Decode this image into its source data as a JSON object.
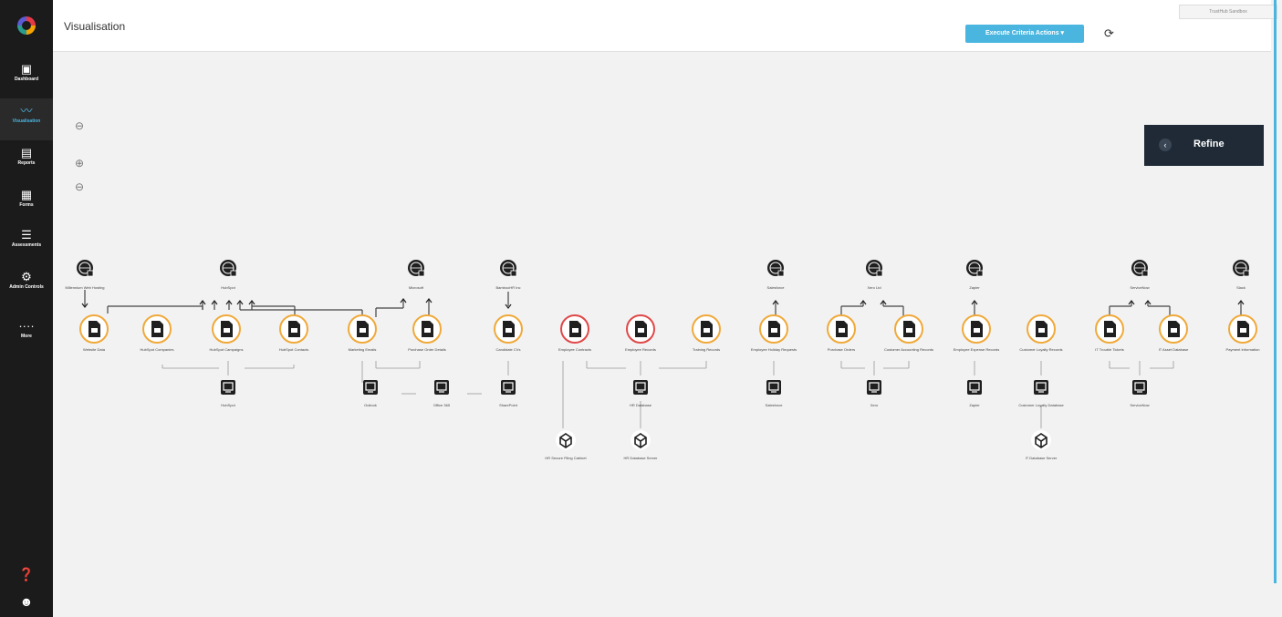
{
  "app": {
    "tenant_label": "TrustHub Sandbox"
  },
  "sidebar": {
    "items": [
      {
        "label": "Dashboard",
        "icon": "dashboard-icon"
      },
      {
        "label": "Visualisation",
        "icon": "chart-line-icon",
        "active": true
      },
      {
        "label": "Reports",
        "icon": "report-icon"
      },
      {
        "label": "Forms",
        "icon": "forms-icon"
      },
      {
        "label": "Assessments",
        "icon": "assessments-icon"
      },
      {
        "label": "Admin Controls",
        "icon": "gear-icon"
      },
      {
        "label": "More",
        "icon": "more-icon"
      }
    ],
    "help_icon": "help-icon",
    "user_icon": "user-icon"
  },
  "header": {
    "title": "Visualisation",
    "execute_button": "Execute Criteria Actions ▾",
    "refresh_icon": "refresh-icon"
  },
  "toolbar": {
    "fit_icon": "fit-view-icon",
    "zoom_in_icon": "zoom-in-icon",
    "zoom_out_icon": "zoom-out-icon"
  },
  "refine": {
    "label": "Refine"
  },
  "colors": {
    "accent": "#4ab6e0",
    "orange_ring": "#f0a93a",
    "red_ring": "#e04848",
    "sidebar": "#1b1b1b",
    "refine_bg": "#1f2a36"
  },
  "graph": {
    "vendors": [
      {
        "id": "v1",
        "label": "Millennium Web Hosting"
      },
      {
        "id": "v2",
        "label": "HubSpot"
      },
      {
        "id": "v3",
        "label": "Microsoft"
      },
      {
        "id": "v4",
        "label": "BambooHR Inc"
      },
      {
        "id": "v5",
        "label": "Salesforce"
      },
      {
        "id": "v6",
        "label": "Xero Ltd"
      },
      {
        "id": "v7",
        "label": "Zapier"
      },
      {
        "id": "v8",
        "label": "ServiceNow"
      },
      {
        "id": "v9",
        "label": "Slack"
      }
    ],
    "records": [
      {
        "label": "Website Data",
        "ring": "orange"
      },
      {
        "label": "HubSpot Companies",
        "ring": "orange"
      },
      {
        "label": "HubSpot Campaigns",
        "ring": "orange"
      },
      {
        "label": "HubSpot Contacts",
        "ring": "orange"
      },
      {
        "label": "Marketing Emails",
        "ring": "orange"
      },
      {
        "label": "Purchase Order Details",
        "ring": "orange"
      },
      {
        "label": "Candidate CVs",
        "ring": "orange"
      },
      {
        "label": "Employee Contracts",
        "ring": "red"
      },
      {
        "label": "Employee Records",
        "ring": "red"
      },
      {
        "label": "Training Records",
        "ring": "orange"
      },
      {
        "label": "Employee Holiday Requests",
        "ring": "orange"
      },
      {
        "label": "Purchase Orders",
        "ring": "orange"
      },
      {
        "label": "Customer Accounting Records",
        "ring": "orange"
      },
      {
        "label": "Employee Expense Records",
        "ring": "orange"
      },
      {
        "label": "Customer Loyalty Records",
        "ring": "orange"
      },
      {
        "label": "IT Trouble Tickets",
        "ring": "orange"
      },
      {
        "label": "IT Asset Database",
        "ring": "orange"
      },
      {
        "label": "Payment Information",
        "ring": "orange"
      }
    ],
    "systems": [
      {
        "label": "HubSpot"
      },
      {
        "label": "Outlook"
      },
      {
        "label": "Office 365"
      },
      {
        "label": "SharePoint"
      },
      {
        "label": "HR Database"
      },
      {
        "label": "Salesforce"
      },
      {
        "label": "Xero"
      },
      {
        "label": "Zapier"
      },
      {
        "label": "Customer Loyalty Database"
      },
      {
        "label": "ServiceNow"
      }
    ],
    "datastores": [
      {
        "label": "HR Secure Filing Cabinet"
      },
      {
        "label": "HR Database Server"
      },
      {
        "label": "IT Database Server"
      }
    ]
  }
}
